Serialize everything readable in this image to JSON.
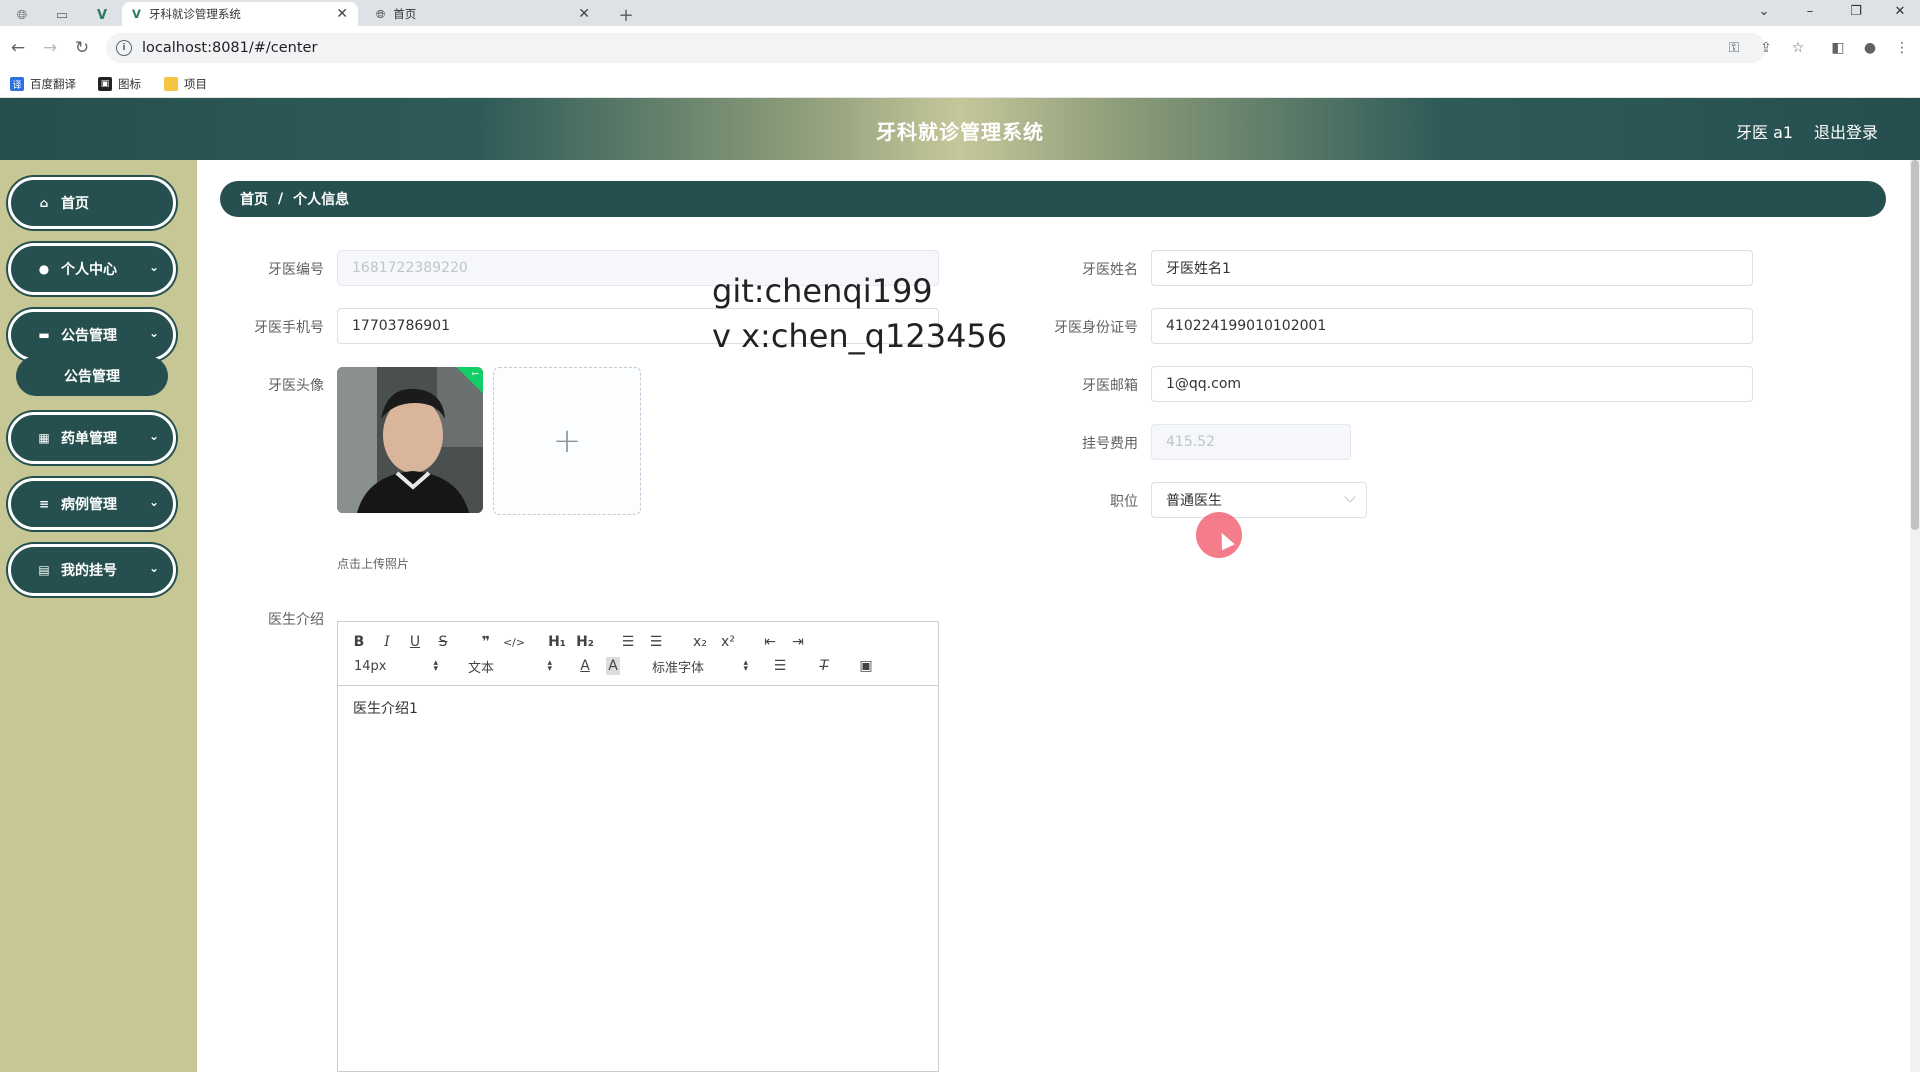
{
  "browser": {
    "tabs": [
      {
        "title": "牙科就诊管理系统",
        "active": true
      },
      {
        "title": "首页",
        "active": false
      }
    ],
    "url": "localhost:8081/#/center",
    "bookmarks": [
      "百度翻译",
      "图标",
      "项目"
    ]
  },
  "header": {
    "title": "牙科就诊管理系统",
    "user": "牙医 a1",
    "logout": "退出登录"
  },
  "sidebar": {
    "items": [
      {
        "label": "首页",
        "icon": "home-icon"
      },
      {
        "label": "个人中心",
        "icon": "user-icon"
      },
      {
        "label": "公告管理",
        "icon": "monitor-icon"
      },
      {
        "label": "药单管理",
        "icon": "grid-icon"
      },
      {
        "label": "病例管理",
        "icon": "list-icon"
      },
      {
        "label": "我的挂号",
        "icon": "clipboard-icon"
      }
    ],
    "submenu": {
      "label": "公告管理"
    }
  },
  "breadcrumb": {
    "home": "首页",
    "current": "个人信息"
  },
  "form": {
    "dentist_no": {
      "label": "牙医编号",
      "value": "1681722389220"
    },
    "dentist_name": {
      "label": "牙医姓名",
      "value": "牙医姓名1"
    },
    "phone": {
      "label": "牙医手机号",
      "value": "17703786901"
    },
    "id_card": {
      "label": "牙医身份证号",
      "value": "410224199010102001"
    },
    "avatar": {
      "label": "牙医头像",
      "tip": "点击上传照片"
    },
    "email": {
      "label": "牙医邮箱",
      "value": "1@qq.com"
    },
    "fee": {
      "label": "挂号费用",
      "value": "415.52"
    },
    "position": {
      "label": "职位",
      "value": "普通医生"
    },
    "intro": {
      "label": "医生介绍",
      "content": "医生介绍1",
      "toolbar": {
        "size": "14px",
        "header": "文本",
        "font": "标准字体"
      }
    }
  },
  "watermark": {
    "line1": "git:chenqi199",
    "line2": "v x:chen_q123456"
  },
  "colors": {
    "primary": "#26504f",
    "sidebar_bg": "#c6c795"
  }
}
